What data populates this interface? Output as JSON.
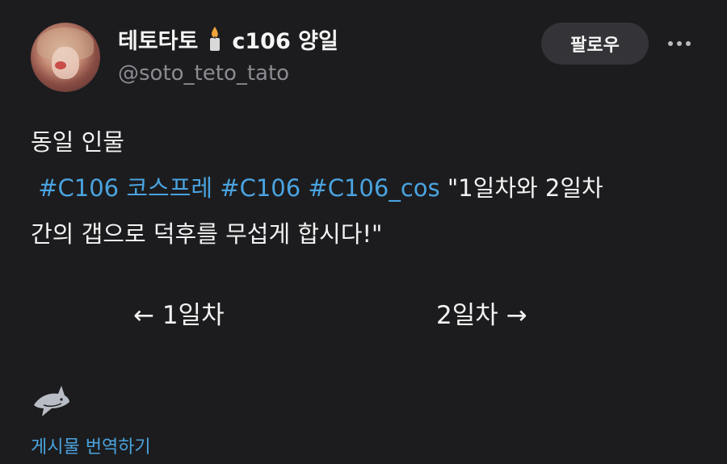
{
  "author": {
    "display_name_part1": "테토타토",
    "display_name_part2": "c106 양일",
    "handle": "@soto_teto_tato",
    "avatar_icon": "avatar",
    "name_emoji_icon": "candle-icon"
  },
  "actions": {
    "follow_label": "팔로우",
    "more_icon": "more-dots-icon"
  },
  "post": {
    "line1": " 동일 인물",
    "hashtags": [
      "#C106",
      "코스프레",
      "#C106",
      "#C106_cos"
    ],
    "line2_quote": " \"1일차와 2일차",
    "line3": "간의 갭으로 덕후를 무섭게 합시다!\"",
    "day1_label": "← 1일차",
    "day2_label": "2일차 →"
  },
  "footer": {
    "mascot_icon": "shark-icon",
    "translate_label": "게시물 번역하기"
  },
  "colors": {
    "background": "#1c1c1e",
    "link": "#4aa3df",
    "muted": "#8b8b92",
    "button_bg": "#343438"
  }
}
